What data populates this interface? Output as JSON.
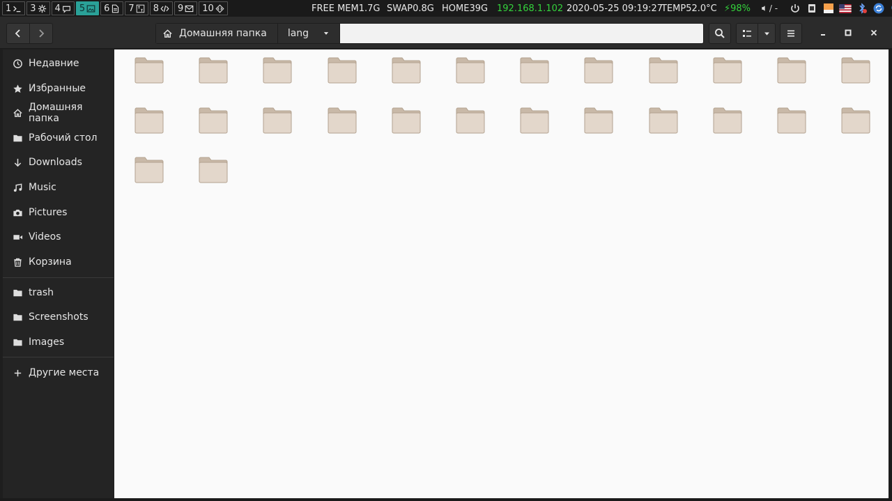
{
  "topbar": {
    "workspaces": [
      {
        "num": "1",
        "icon": "terminal-icon"
      },
      {
        "num": "3",
        "icon": "gear-icon"
      },
      {
        "num": "4",
        "icon": "chat-icon"
      },
      {
        "num": "5",
        "icon": "image-icon",
        "active": true
      },
      {
        "num": "6",
        "icon": "document-icon"
      },
      {
        "num": "7",
        "icon": "font-icon"
      },
      {
        "num": "8",
        "icon": "code-icon"
      },
      {
        "num": "9",
        "icon": "mail-icon"
      },
      {
        "num": "10",
        "icon": "diamond-code-icon"
      }
    ],
    "free_mem": "FREE MEM1.7G",
    "swap": "SWAP0.8G",
    "home": "HOME39G",
    "ip": "192.168.1.102",
    "datetime": "2020-05-25 09:19:27",
    "temp": "TEMP52.0°C",
    "battery": "⚡98%",
    "volume": "/ -",
    "colors": {
      "active_ws": "#2aa198",
      "ip": "#34d23c",
      "battery": "#34d23c"
    }
  },
  "headerbar": {
    "back_icon": "chevron-left-icon",
    "forward_icon": "chevron-right-icon",
    "path": [
      {
        "label": "Домашняя папка",
        "icon": "home-icon"
      },
      {
        "label": "lang",
        "icon": "triangle-down-icon"
      }
    ],
    "search_icon": "search-icon",
    "view_icon": "list-view-icon",
    "view_dropdown_icon": "triangle-down-icon",
    "menu_icon": "hamburger-icon",
    "window_controls": [
      "minimize-icon",
      "maximize-icon",
      "close-icon"
    ]
  },
  "sidebar": {
    "items": [
      {
        "label": "Недавние",
        "icon": "clock-icon"
      },
      {
        "label": "Избранные",
        "icon": "star-icon"
      },
      {
        "label": "Домашняя папка",
        "icon": "home-icon"
      },
      {
        "label": "Рабочий стол",
        "icon": "folder-icon"
      },
      {
        "label": "Downloads",
        "icon": "arrow-down-icon"
      },
      {
        "label": "Music",
        "icon": "music-icon"
      },
      {
        "label": "Pictures",
        "icon": "camera-icon"
      },
      {
        "label": "Videos",
        "icon": "video-icon"
      },
      {
        "label": "Корзина",
        "icon": "trash-icon"
      }
    ],
    "bookmarks": [
      {
        "label": "trash",
        "icon": "folder-icon"
      },
      {
        "label": "Screenshots",
        "icon": "folder-icon"
      },
      {
        "label": "Images",
        "icon": "folder-icon"
      }
    ],
    "other": {
      "label": "Другие места",
      "icon": "plus-icon"
    }
  },
  "folders": {
    "count": 26,
    "icon": "folder-icon",
    "colors": {
      "body": "#e3d7cb",
      "tab": "#c9b9a8",
      "outline": "#b3a290"
    }
  }
}
